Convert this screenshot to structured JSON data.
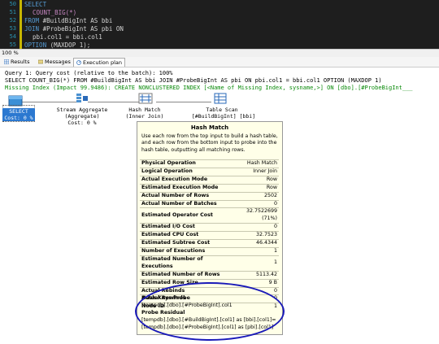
{
  "editor": {
    "lines": [
      {
        "num": "50",
        "kw": "SELECT",
        "rest": ""
      },
      {
        "num": "51",
        "kw": "",
        "rest": "COUNT_BIG(*)"
      },
      {
        "num": "52",
        "kw": "FROM",
        "rest": " #BuildBigInt AS bbi"
      },
      {
        "num": "53",
        "kw": "JOIN",
        "rest": " #ProbeBigInt AS pbi ON"
      },
      {
        "num": "54",
        "kw": "",
        "rest": "pbi.col1 = bbi.col1"
      },
      {
        "num": "55",
        "kw": "OPTION",
        "rest": " (MAXDOP 1);"
      }
    ]
  },
  "zoom": "100 %",
  "tabs": [
    {
      "label": "Results",
      "icon": "grid-icon"
    },
    {
      "label": "Messages",
      "icon": "message-icon"
    },
    {
      "label": "Execution plan",
      "icon": "plan-icon"
    }
  ],
  "query": {
    "line1": "Query 1: Query cost (relative to the batch): 100%",
    "line2": "SELECT COUNT_BIG(*) FROM #BuildBigInt AS bbi JOIN #ProbeBigInt AS pbi ON pbi.col1 = bbi.col1 OPTION (MAXDOP 1)",
    "missing": "Missing Index (Impact 99.9486): CREATE NONCLUSTERED INDEX [<Name of Missing Index, sysname,>] ON [dbo].[#ProbeBigInt___"
  },
  "operators": [
    {
      "name": "select",
      "l1": "SELECT",
      "l2": "Cost: 0 %"
    },
    {
      "name": "stream-aggregate",
      "l1": "Stream Aggregate",
      "l2": "(Aggregate)",
      "l3": "Cost: 0 %"
    },
    {
      "name": "hash-match",
      "l1": "Hash Match",
      "l2": "(Inner Join)",
      "l3": "Cost: 71 %"
    },
    {
      "name": "table-scan",
      "l1": "Table Scan",
      "l2": "[#BuildBigInt] [bbi]"
    }
  ],
  "tooltip": {
    "title": "Hash Match",
    "description": "Use each row from the top input to build a hash table, and each row from the bottom input to probe into the hash table, outputting all matching rows.",
    "rows": [
      {
        "k": "Physical Operation",
        "v": "Hash Match"
      },
      {
        "k": "Logical Operation",
        "v": "Inner Join"
      },
      {
        "k": "Actual Execution Mode",
        "v": "Row"
      },
      {
        "k": "Estimated Execution Mode",
        "v": "Row"
      },
      {
        "k": "Actual Number of Rows",
        "v": "2502"
      },
      {
        "k": "Actual Number of Batches",
        "v": "0"
      },
      {
        "k": "Estimated Operator Cost",
        "v": "32.7522699 (71%)"
      },
      {
        "k": "Estimated I/O Cost",
        "v": "0"
      },
      {
        "k": "Estimated CPU Cost",
        "v": "32.7523"
      },
      {
        "k": "Estimated Subtree Cost",
        "v": "46.4344"
      },
      {
        "k": "Number of Executions",
        "v": "1"
      },
      {
        "k": "Estimated Number of Executions",
        "v": "1"
      },
      {
        "k": "Estimated Number of Rows",
        "v": "5113.42"
      },
      {
        "k": "Estimated Row Size",
        "v": "9 B"
      },
      {
        "k": "Actual Rebinds",
        "v": "0"
      },
      {
        "k": "Actual Rewinds",
        "v": "0"
      },
      {
        "k": "Node ID",
        "v": "1"
      }
    ],
    "hash_keys_label": "Hash Keys Probe",
    "hash_keys_value": "[tempdb].[dbo].[#ProbeBigInt].col1",
    "residual_label": "Probe Residual",
    "residual_value1": "[tempdb].[dbo].[#BuildBigInt].[col1] as [bbi].[col1]=",
    "residual_value2": "[tempdb].[dbo].[#ProbeBigInt].[col1] as [pbi].[col1]"
  },
  "colors": {
    "accent": "#1a1ab8",
    "keyword": "#569cd6",
    "missing": "#0a8a0a"
  }
}
